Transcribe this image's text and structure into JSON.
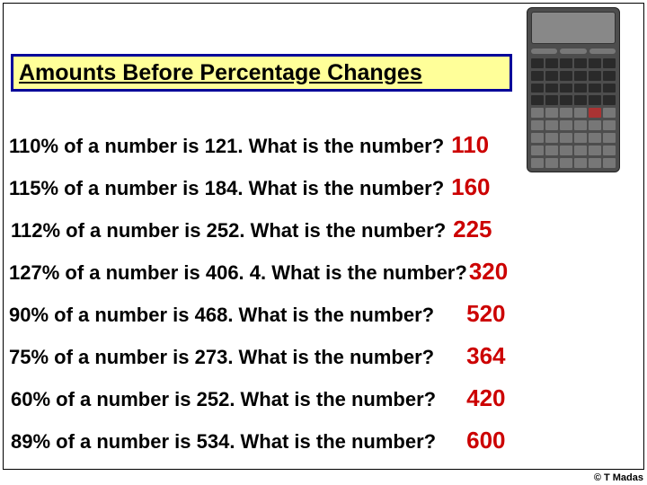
{
  "title": "Amounts Before Percentage Changes",
  "questions": [
    {
      "text": "110% of a number is 121. What is the number?",
      "answer": "110"
    },
    {
      "text": "115% of a number is 184. What is the number?",
      "answer": "160"
    },
    {
      "text": "112% of a number is 252. What is the number?",
      "answer": "225"
    },
    {
      "text": "127% of a number is 406. 4. What is the number?",
      "answer": "320"
    },
    {
      "text": "90% of a number is 468. What is the number?",
      "answer": "520"
    },
    {
      "text": "75% of a number is 273. What is the number?",
      "answer": "364"
    },
    {
      "text": "60% of a number is 252. What is the number?",
      "answer": "420"
    },
    {
      "text": "89% of a number is 534. What is the number?",
      "answer": "600"
    }
  ],
  "copyright": "© T Madas"
}
